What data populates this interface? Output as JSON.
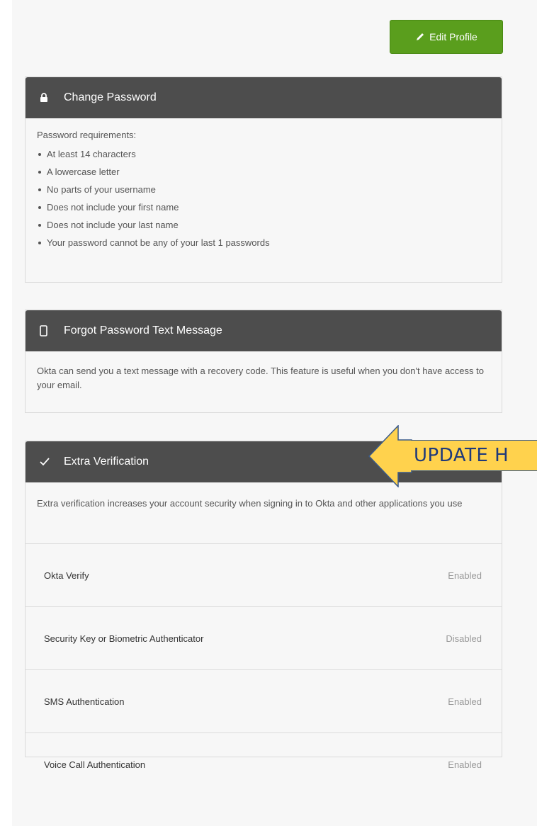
{
  "header": {
    "edit_profile_label": "Edit Profile"
  },
  "change_password": {
    "title": "Change Password",
    "intro": "Password requirements:",
    "requirements": [
      "At least 14 characters",
      "A lowercase letter",
      "No parts of your username",
      "Does not include your first name",
      "Does not include your last name",
      "Your password cannot be any of your last 1 passwords"
    ]
  },
  "forgot_password_sms": {
    "title": "Forgot Password Text Message",
    "description": "Okta can send you a text message with a recovery code. This feature is useful when you don't have access to your email."
  },
  "extra_verification": {
    "title": "Extra Verification",
    "description": "Extra verification increases your account security when signing in to Okta and other applications you use",
    "factors": [
      {
        "name": "Okta Verify",
        "status": "Enabled"
      },
      {
        "name": "Security Key or Biometric Authenticator",
        "status": "Disabled"
      },
      {
        "name": "SMS Authentication",
        "status": "Enabled"
      },
      {
        "name": "Voice Call Authentication",
        "status": "Enabled"
      }
    ]
  },
  "annotation": {
    "text": "UPDATE H"
  },
  "colors": {
    "edit_button": "#5a9e1d",
    "section_header": "#4d4d4d",
    "callout_fill": "#ffd24d",
    "callout_text": "#1f3a7a"
  }
}
